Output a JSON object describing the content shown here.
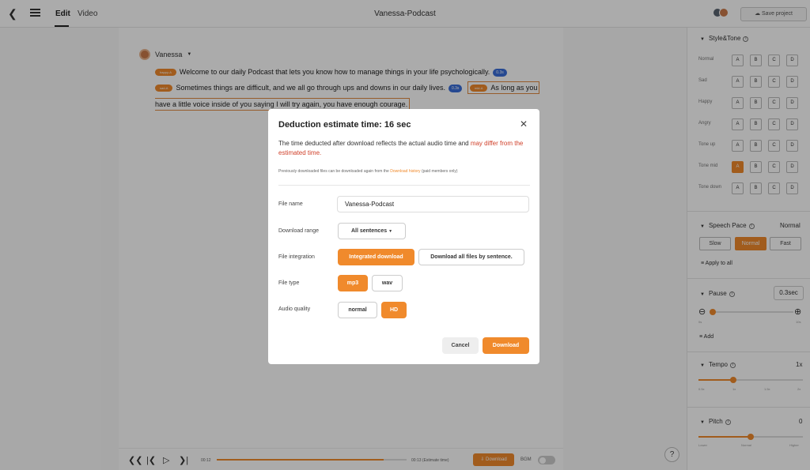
{
  "header": {
    "tab_edit": "Edit",
    "tab_video": "Video",
    "title": "Vanessa-Podcast",
    "save_project": "Save project"
  },
  "editor": {
    "speaker": "Vanessa",
    "line1": {
      "chip": "happy-A",
      "text": "Welcome to our daily Podcast that lets you know how to manage things in your life psychologically.",
      "pause": "0.3s"
    },
    "line2": {
      "chip": "sad-A",
      "text": "Sometimes things are difficult, and we all go through ups and downs in our daily lives.",
      "pause": "0.3s",
      "chip2": "mid-A",
      "text2": "As long as you"
    },
    "line3": {
      "text": "have a little voice inside of you saying I will try again, you have enough courage."
    }
  },
  "player": {
    "current": "00:12",
    "estimate": "00:13 (Estimate time)",
    "download": "Download",
    "bgm": "BGM",
    "progress": 0.88
  },
  "right_panel": {
    "style_tone": {
      "title": "Style&Tone",
      "rows": [
        "Normal",
        "Sad",
        "Happy",
        "Angry",
        "Tone up",
        "Tone mid",
        "Tone down"
      ],
      "options": [
        "A",
        "B",
        "C",
        "D"
      ],
      "selected_row": "Tone mid",
      "selected_option": "A"
    },
    "speech_pace": {
      "title": "Speech Pace",
      "value": "Normal",
      "options": [
        "Slow",
        "Normal",
        "Fast"
      ],
      "selected": "Normal",
      "apply": "Apply to all"
    },
    "pause": {
      "title": "Pause",
      "value": "0.3sec",
      "min": "0s",
      "max": "10s",
      "add": "Add",
      "level": 0.03
    },
    "tempo": {
      "title": "Tempo",
      "value": "1x",
      "ticks": [
        "0.5x",
        "1x",
        "1.5x",
        "2x"
      ],
      "level": 0.33
    },
    "pitch": {
      "title": "Pitch",
      "value": "0",
      "ticks": [
        "Lower",
        "Normal",
        "Higher"
      ],
      "level": 0.5
    }
  },
  "modal": {
    "title": "Deduction estimate time: 16 sec",
    "desc_a": "The time deducted after download reflects the actual audio time and ",
    "desc_b": "may differ from the estimated time.",
    "note_a": "Previously downloaded files can be downloaded again from the ",
    "note_link": "Download history",
    "note_b": " (paid members only)",
    "file_name_label": "File name",
    "file_name_value": "Vanessa-Podcast",
    "range_label": "Download range",
    "range_value": "All sentences",
    "integration_label": "File integration",
    "integration_options": [
      "Integrated download",
      "Download all files by sentence."
    ],
    "type_label": "File type",
    "type_options": [
      "mp3",
      "wav"
    ],
    "quality_label": "Audio quality",
    "quality_options": [
      "normal",
      "HD"
    ],
    "cancel": "Cancel",
    "download": "Download"
  },
  "help": "?",
  "colors": {
    "accent": "#f08a2c",
    "pause_chip": "#3a6ed8",
    "warning": "#d0402a"
  }
}
